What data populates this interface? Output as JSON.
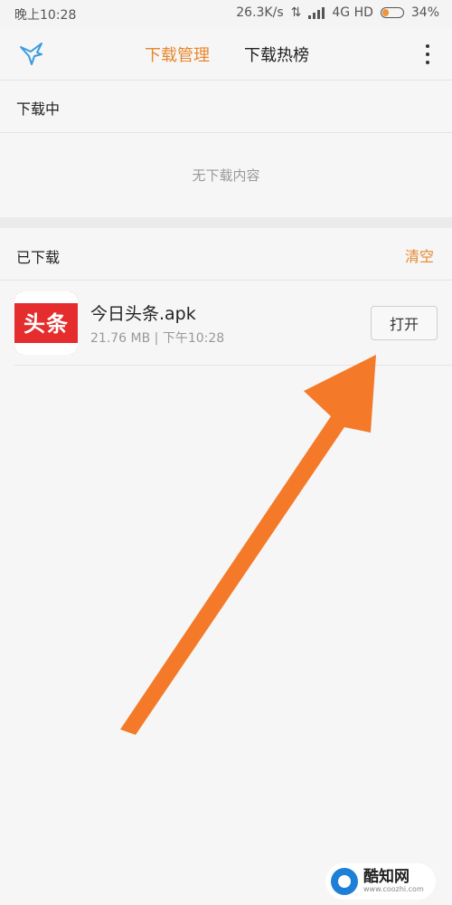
{
  "status_bar": {
    "time": "晚上10:28",
    "network_speed": "26.3K/s",
    "network_type": "4G HD",
    "battery": "34%",
    "battery_level": 0.34
  },
  "header": {
    "logo_icon": "bird-logo-icon",
    "tabs": [
      {
        "label": "下载管理",
        "active": true
      },
      {
        "label": "下载热榜",
        "active": false
      }
    ],
    "menu_icon": "more-vertical-icon"
  },
  "downloading": {
    "title": "下载中",
    "empty_text": "无下载内容"
  },
  "downloaded": {
    "title": "已下载",
    "clear_label": "清空",
    "items": [
      {
        "icon_text": "头条",
        "name": "今日头条.apk",
        "meta": "21.76 MB | 下午10:28",
        "action_label": "打开"
      }
    ]
  },
  "watermark": {
    "name": "酷知网",
    "url": "www.coozhi.com"
  },
  "colors": {
    "accent": "#e8872c",
    "arrow": "#f47a2a",
    "icon_red": "#e52d2d"
  }
}
